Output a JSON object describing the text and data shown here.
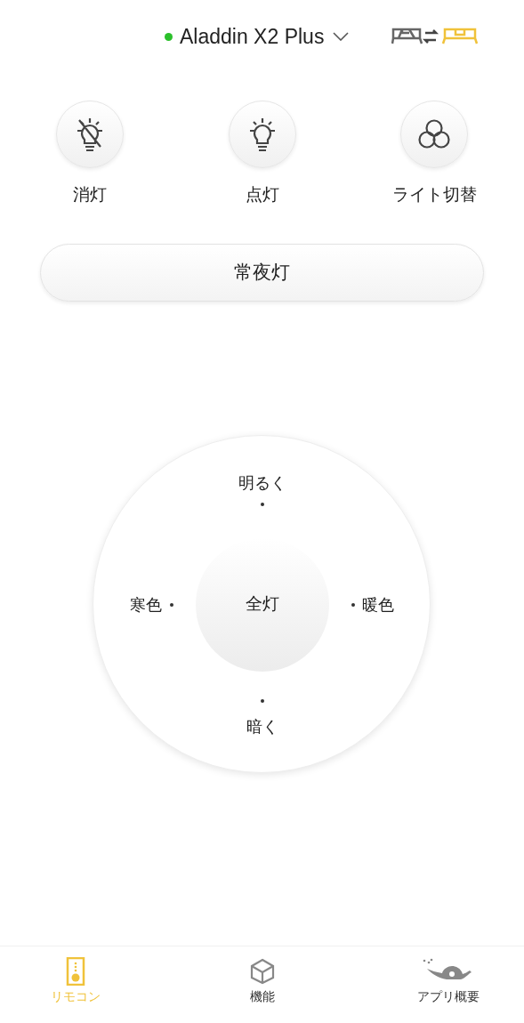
{
  "header": {
    "device_name": "Aladdin X2 Plus",
    "connected": true
  },
  "actions": [
    {
      "kind": "light-off",
      "label": "消灯"
    },
    {
      "kind": "light-on",
      "label": "点灯"
    },
    {
      "kind": "switch",
      "label": "ライト切替"
    }
  ],
  "night_light": {
    "label": "常夜灯"
  },
  "dial": {
    "up": "明るく",
    "left": "寒色",
    "center": "全灯",
    "right": "暖色",
    "down": "暗く"
  },
  "tabs": [
    {
      "kind": "remote",
      "label": "リモコン",
      "selected": true
    },
    {
      "kind": "features",
      "label": "機能",
      "selected": false
    },
    {
      "kind": "about",
      "label": "アプリ概要",
      "selected": false
    }
  ]
}
